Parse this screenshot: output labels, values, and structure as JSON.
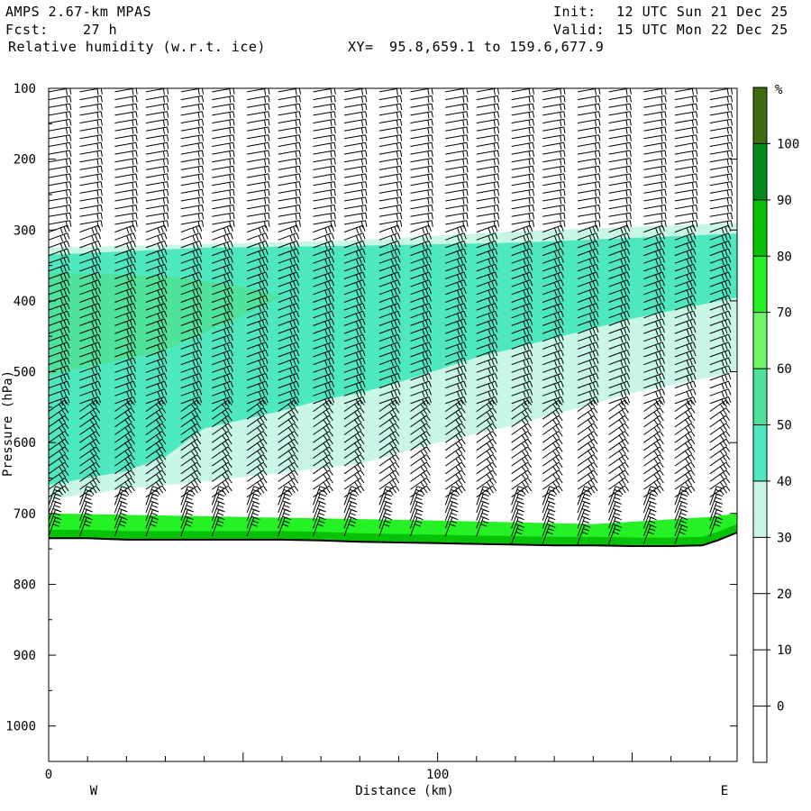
{
  "header": {
    "model": "AMPS 2.67-km MPAS",
    "fcst_label": "Fcst:",
    "fcst_value": "27 h",
    "field": "Relative humidity (w.r.t. ice)",
    "xy_label": "XY=",
    "xy_value": "95.8,659.1 to 159.6,677.9",
    "init_label": "Init:",
    "init_value": "12 UTC Sun 21 Dec 25",
    "valid_label": "Valid:",
    "valid_value": "15 UTC Mon 22 Dec 25"
  },
  "colorbar": {
    "unit": "%",
    "labels": [
      "0",
      "10",
      "20",
      "30",
      "40",
      "50",
      "60",
      "70",
      "80",
      "90",
      "100"
    ],
    "colors": [
      "#ffffff",
      "#ffffff",
      "#ffffff",
      "#c8f7e6",
      "#4ee8c0",
      "#4fe29a",
      "#6ef56a",
      "#24f224",
      "#07c107",
      "#048a1e",
      "#3f6b10"
    ]
  },
  "chart_data": {
    "type": "heatmap",
    "xlabel": "Distance (km)",
    "ylabel": "Pressure (hPa)",
    "xlim": [
      0,
      177
    ],
    "ylim": [
      100,
      1050
    ],
    "y_inverted": true,
    "x_ticks": [
      "0",
      "100"
    ],
    "x_tick_values": [
      0,
      100
    ],
    "y_ticks": [
      "100",
      "200",
      "300",
      "400",
      "500",
      "600",
      "700",
      "800",
      "900",
      "1000"
    ],
    "y_tick_values": [
      100,
      200,
      300,
      400,
      500,
      600,
      700,
      800,
      900,
      1000
    ],
    "left_end_label": "W",
    "right_end_label": "E",
    "terrain_pressure": [
      [
        0,
        735
      ],
      [
        10,
        735
      ],
      [
        20,
        737
      ],
      [
        30,
        737
      ],
      [
        40,
        737
      ],
      [
        50,
        737
      ],
      [
        60,
        737
      ],
      [
        70,
        738
      ],
      [
        80,
        740
      ],
      [
        90,
        741
      ],
      [
        100,
        742
      ],
      [
        110,
        743
      ],
      [
        120,
        744
      ],
      [
        130,
        745
      ],
      [
        140,
        745
      ],
      [
        150,
        746
      ],
      [
        160,
        746
      ],
      [
        168,
        745
      ],
      [
        172,
        738
      ],
      [
        177,
        727
      ]
    ],
    "layers": [
      {
        "range": "30-40",
        "top": [
          [
            0,
            325
          ],
          [
            40,
            320
          ],
          [
            80,
            314
          ],
          [
            120,
            302
          ],
          [
            177,
            290
          ]
        ],
        "bottom": [
          [
            0,
            680
          ],
          [
            20,
            665
          ],
          [
            40,
            655
          ],
          [
            80,
            630
          ],
          [
            100,
            600
          ],
          [
            120,
            575
          ],
          [
            150,
            530
          ],
          [
            177,
            500
          ]
        ]
      },
      {
        "range": "40-50",
        "top": [
          [
            0,
            335
          ],
          [
            40,
            325
          ],
          [
            80,
            322
          ],
          [
            120,
            318
          ],
          [
            177,
            305
          ]
        ],
        "bottom": [
          [
            0,
            660
          ],
          [
            20,
            640
          ],
          [
            30,
            620
          ],
          [
            40,
            580
          ],
          [
            60,
            555
          ],
          [
            70,
            540
          ],
          [
            80,
            530
          ],
          [
            90,
            515
          ],
          [
            110,
            480
          ],
          [
            150,
            425
          ],
          [
            177,
            395
          ]
        ]
      },
      {
        "range": "50-60",
        "top": [
          [
            0,
            360
          ],
          [
            30,
            365
          ],
          [
            50,
            380
          ],
          [
            60,
            395
          ]
        ],
        "bottom": [
          [
            0,
            505
          ],
          [
            30,
            470
          ],
          [
            60,
            395
          ]
        ]
      },
      {
        "range": "near-surface band",
        "top": [
          [
            0,
            700
          ],
          [
            50,
            705
          ],
          [
            100,
            710
          ],
          [
            140,
            715
          ],
          [
            170,
            705
          ],
          [
            177,
            700
          ]
        ],
        "bottom_is_terrain": true
      }
    ],
    "wind_barb_columns_x": [
      0,
      8,
      17,
      25,
      34,
      42,
      51,
      59,
      68,
      76,
      85,
      93,
      102,
      110,
      119,
      127,
      136,
      144,
      153,
      161,
      170
    ]
  }
}
